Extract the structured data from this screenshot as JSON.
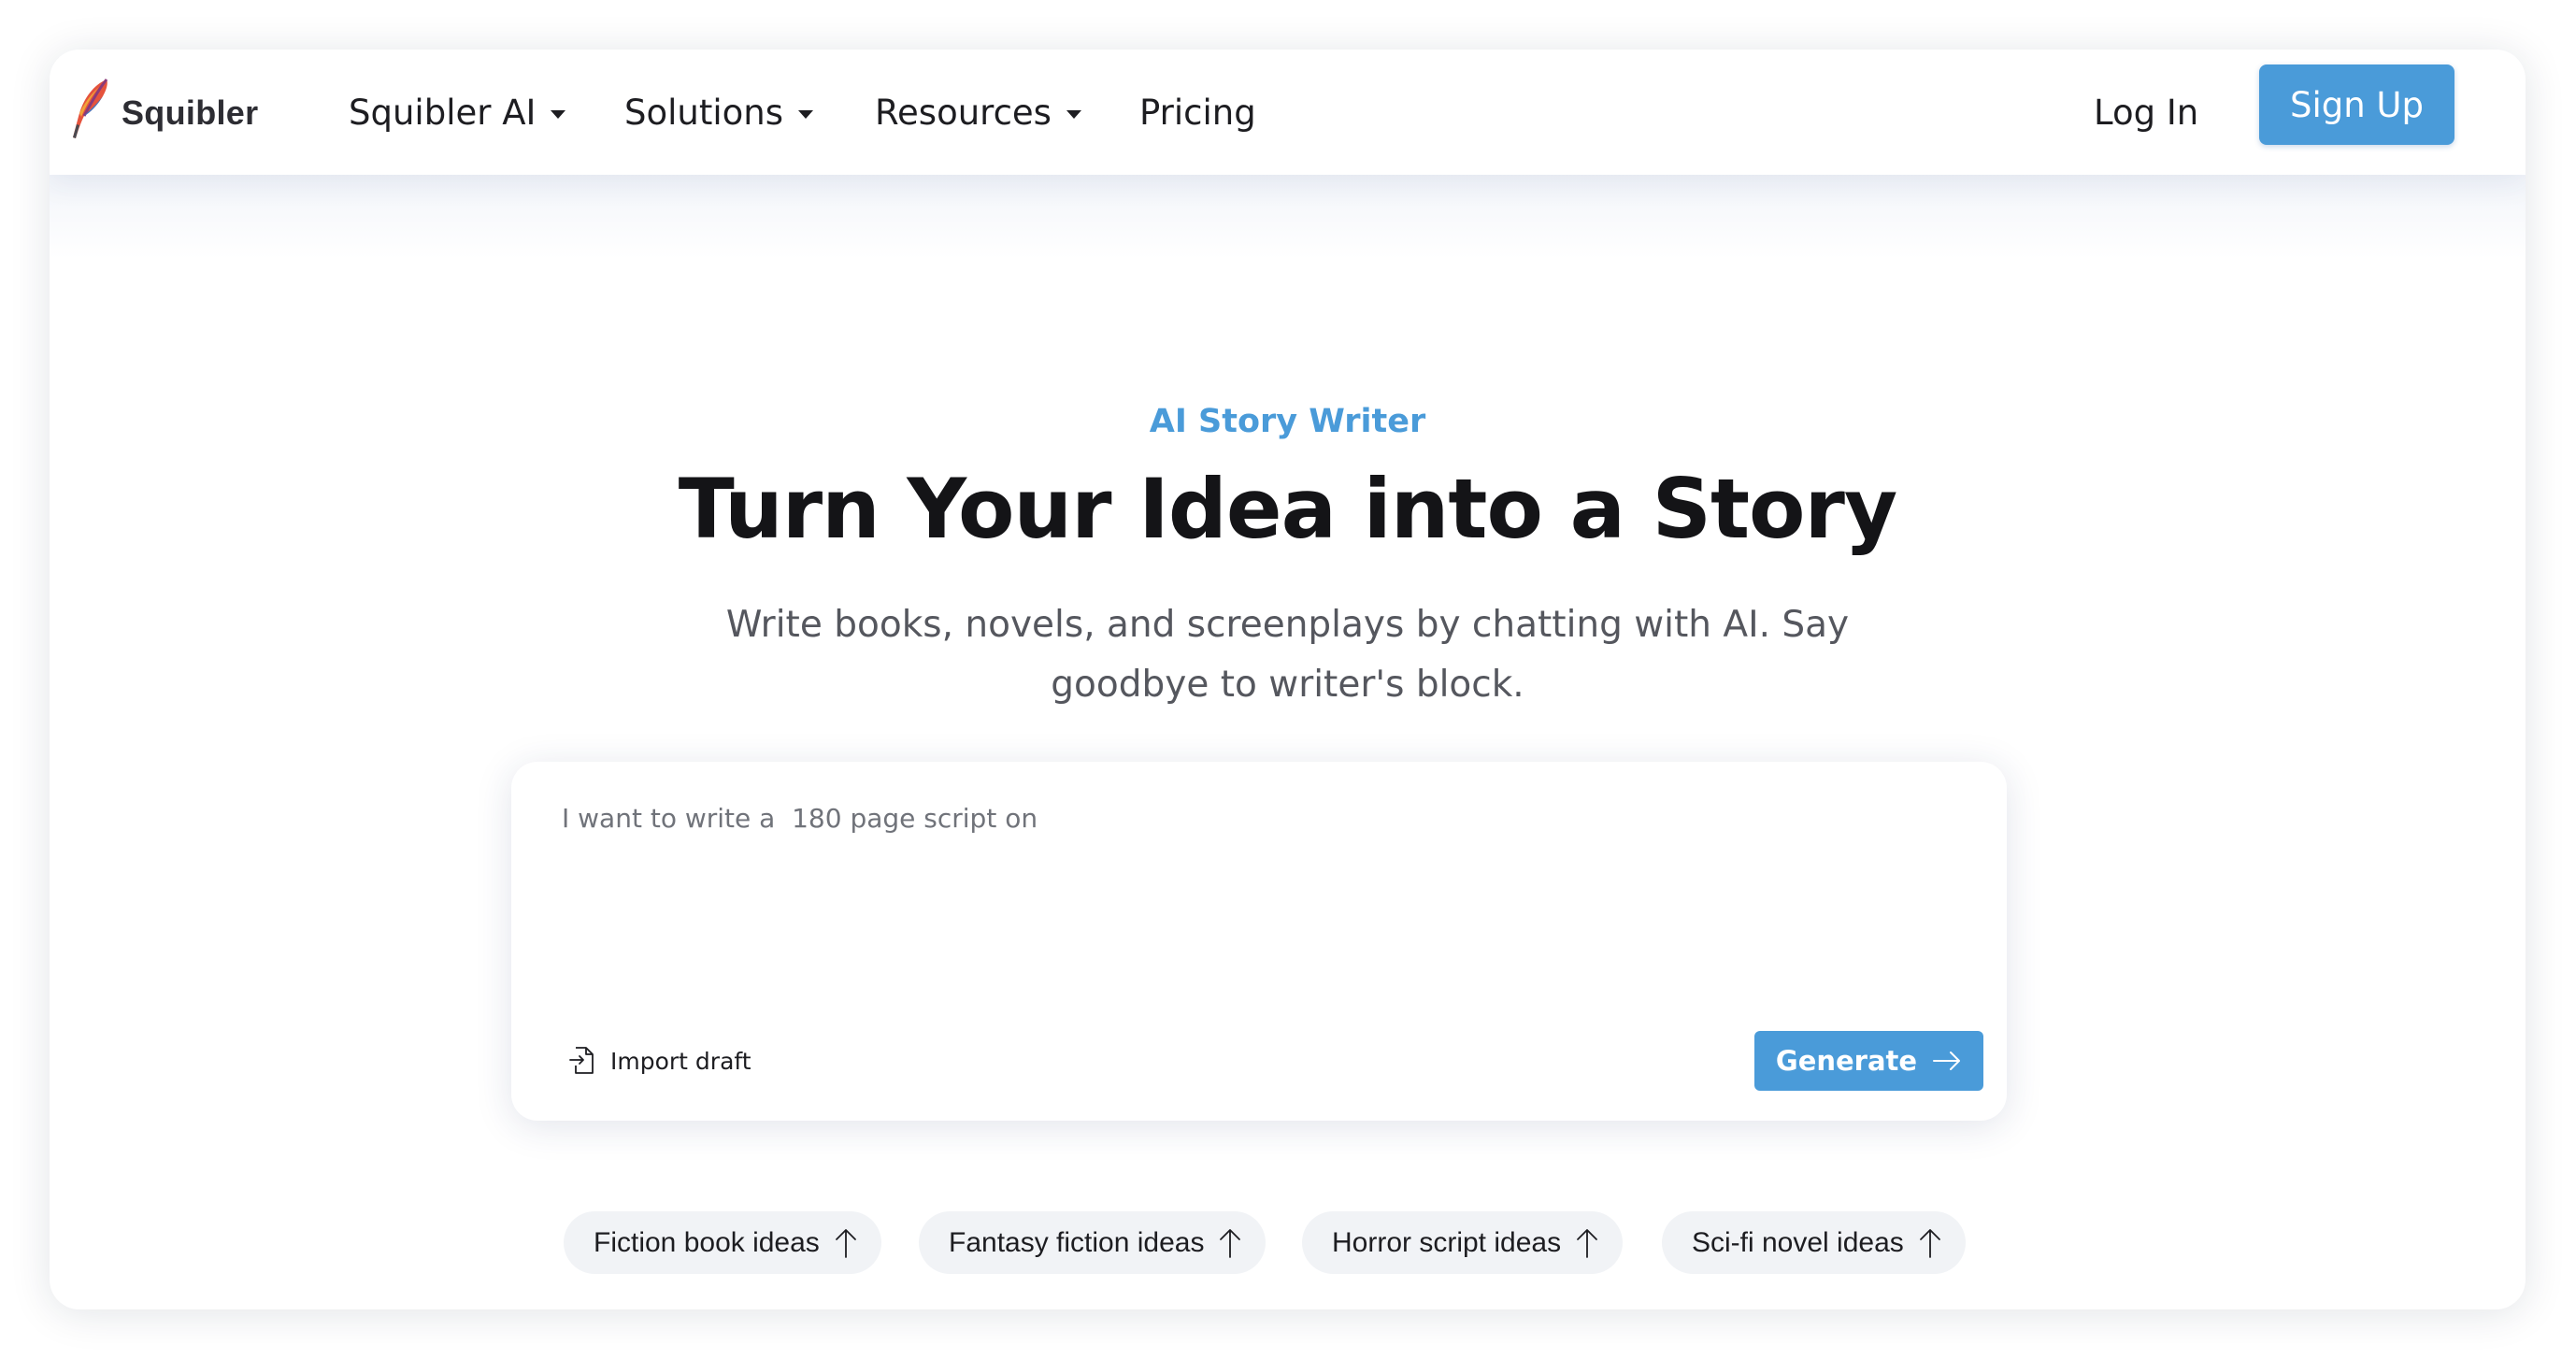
{
  "brand": {
    "name": "Squibler",
    "colors": {
      "accent": "#4a9bd9",
      "text": "#141417",
      "muted": "#55575e",
      "chip_bg": "#f1f3f6"
    }
  },
  "nav": {
    "items": [
      {
        "label": "Squibler AI",
        "has_dropdown": true
      },
      {
        "label": "Solutions",
        "has_dropdown": true
      },
      {
        "label": "Resources",
        "has_dropdown": true
      },
      {
        "label": "Pricing",
        "has_dropdown": false
      }
    ],
    "login_label": "Log In",
    "signup_label": "Sign Up"
  },
  "hero": {
    "eyebrow": "AI Story Writer",
    "title": "Turn Your Idea into a Story",
    "subtitle_line1": "Write books, novels, and screenplays by chatting with AI. Say",
    "subtitle_line2": "goodbye to writer's block."
  },
  "prompt": {
    "value": "I want to write a  180 page script on",
    "import_label": "Import draft",
    "generate_label": "Generate"
  },
  "suggestions": [
    {
      "label": "Fiction book ideas"
    },
    {
      "label": "Fantasy fiction ideas"
    },
    {
      "label": "Horror script ideas"
    },
    {
      "label": "Sci-fi novel ideas"
    }
  ],
  "icons": {
    "logo": "feather-quill-icon",
    "dropdown": "caret-down-icon",
    "import": "file-import-icon",
    "generate": "arrow-right-icon",
    "suggestion": "arrow-up-icon"
  }
}
